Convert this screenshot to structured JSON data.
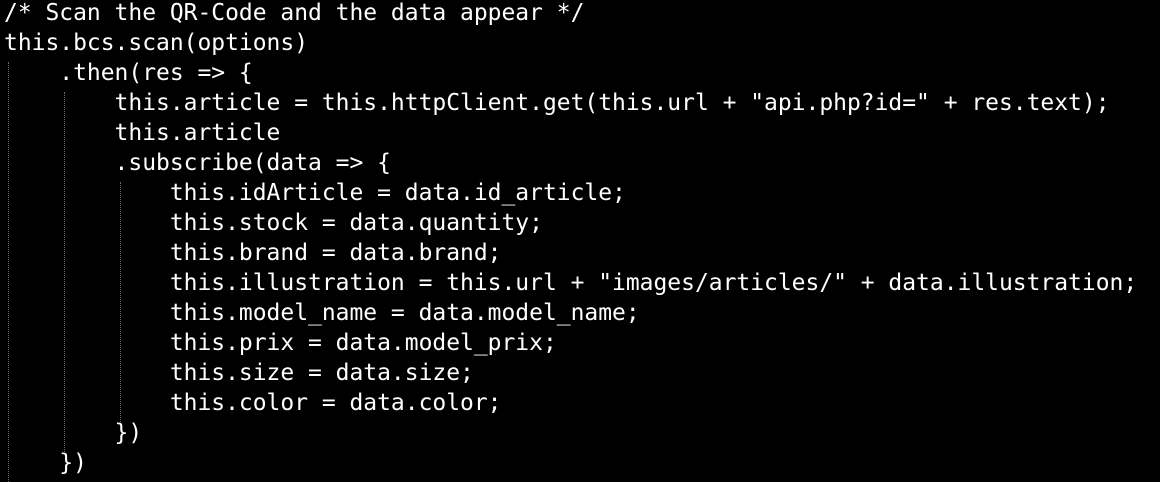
{
  "editor": {
    "background": "#000000",
    "text_color": "#ffffff",
    "guide_color": "#6a6a6a",
    "lines": [
      "/* Scan the QR-Code and the data appear */",
      "this.bcs.scan(options)",
      "    .then(res => {",
      "        this.article = this.httpClient.get(this.url + \"api.php?id=\" + res.text);",
      "        this.article",
      "        .subscribe(data => {",
      "            this.idArticle = data.id_article;",
      "            this.stock = data.quantity;",
      "            this.brand = data.brand;",
      "            this.illustration = this.url + \"images/articles/\" + data.illustration;",
      "            this.model_name = data.model_name;",
      "            this.prix = data.model_prix;",
      "            this.size = data.size;",
      "            this.color = data.color;",
      "        })",
      "    })"
    ]
  }
}
